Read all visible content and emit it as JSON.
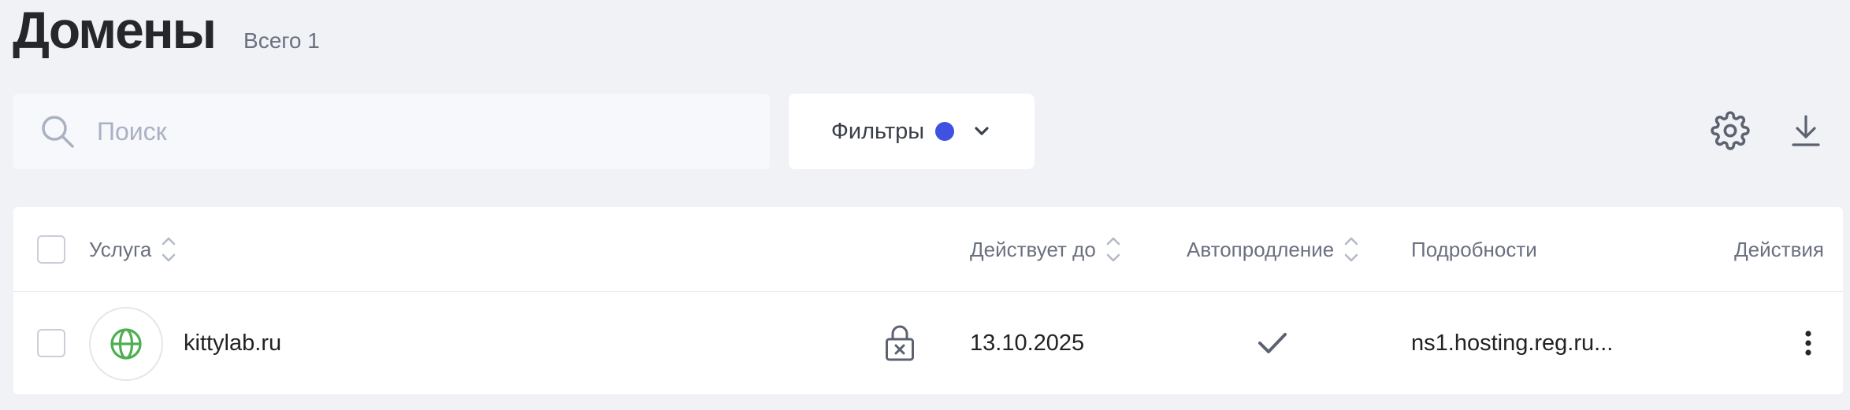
{
  "header": {
    "title": "Домены",
    "total": "Всего 1"
  },
  "search": {
    "placeholder": "Поиск",
    "value": ""
  },
  "filters": {
    "label": "Фильтры",
    "active_indicator_color": "#3f51e0"
  },
  "toolbar": {
    "settings_icon": "gear-icon",
    "download_icon": "download-icon"
  },
  "table": {
    "columns": {
      "service": "Услуга",
      "expires": "Действует до",
      "autorenew": "Автопродление",
      "details": "Подробности",
      "actions": "Действия"
    },
    "rows": [
      {
        "domain": "kittylab.ru",
        "icon": "globe-icon",
        "lock_icon": "lock-icon",
        "expires": "13.10.2025",
        "autorenew": true,
        "details": "ns1.hosting.reg.ru..."
      }
    ]
  },
  "colors": {
    "accent": "#3f51e0",
    "globe": "#4caf50",
    "background": "#f1f2f6"
  }
}
